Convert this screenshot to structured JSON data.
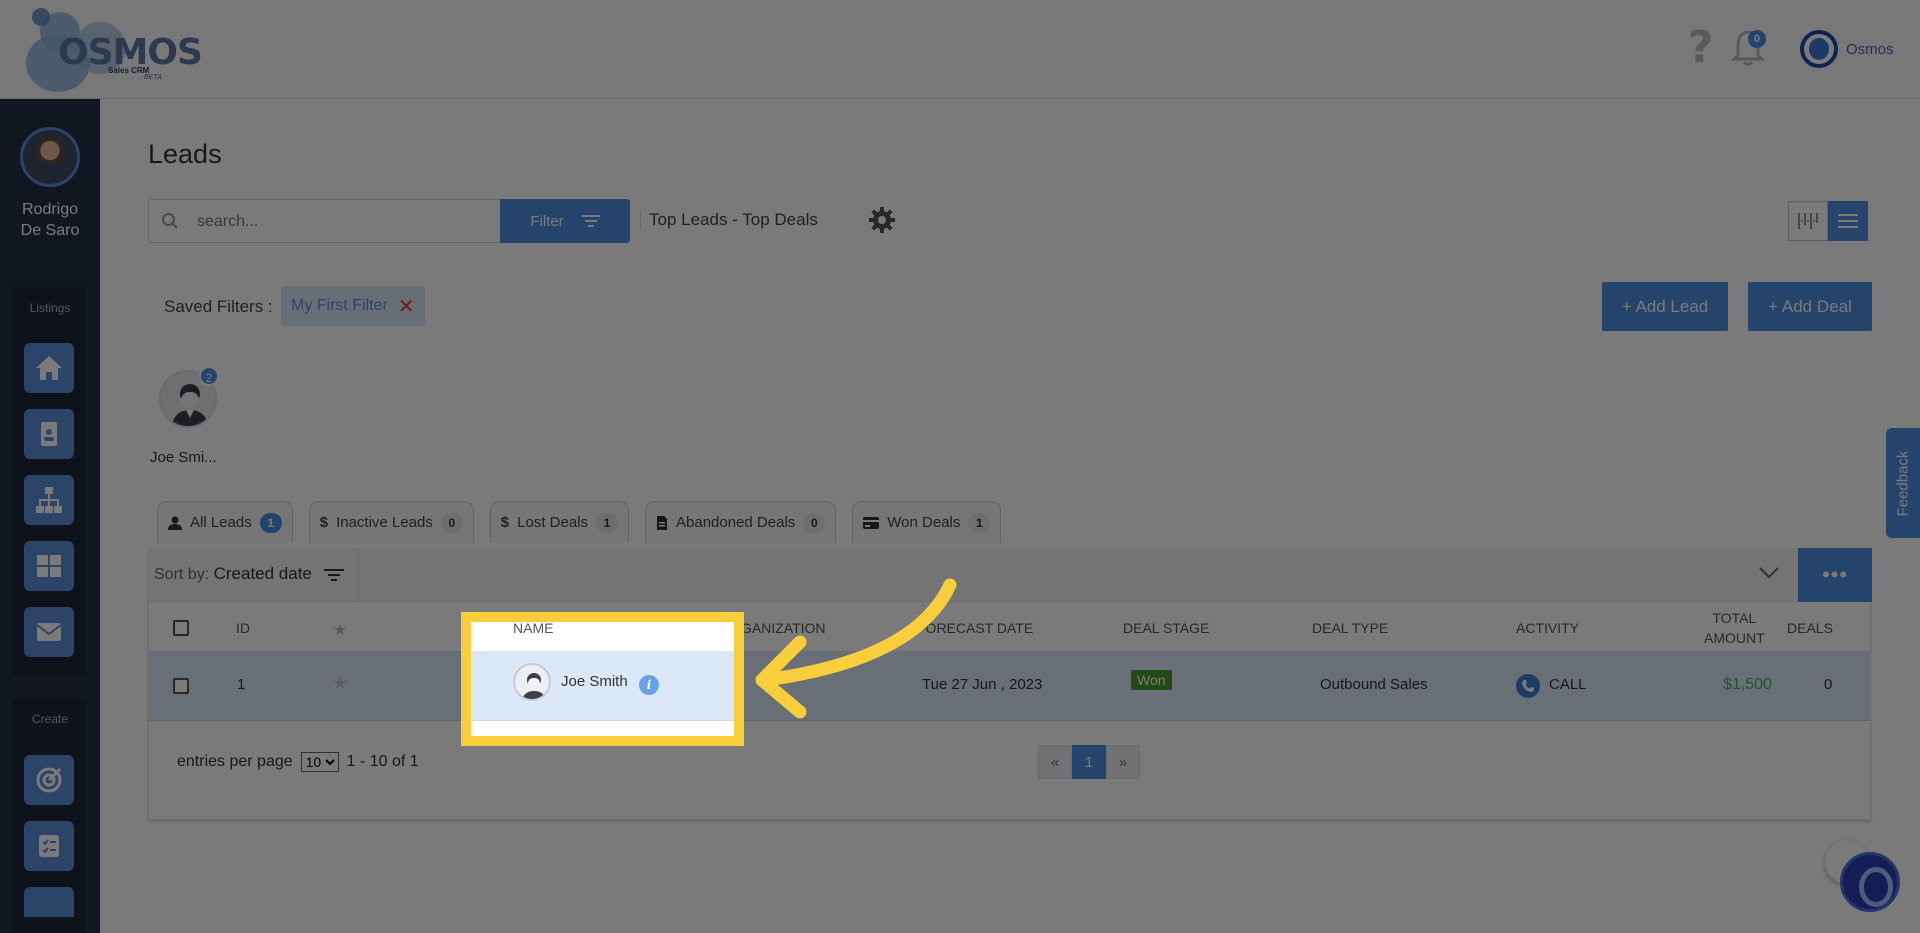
{
  "app": {
    "logo_word": "OSMOS",
    "logo_sub": "Sales CRM",
    "logo_beta": "BETA",
    "notifications_count": "0",
    "top_user": "Osmos"
  },
  "sidebar": {
    "user_first": "Rodrigo",
    "user_last": "De Saro",
    "listings_label": "Listings",
    "create_label": "Create",
    "items": [
      {
        "icon": "home-icon"
      },
      {
        "icon": "contact-card-icon"
      },
      {
        "icon": "org-chart-icon"
      },
      {
        "icon": "grid-icon"
      },
      {
        "icon": "envelope-icon"
      },
      {
        "icon": "target-icon"
      },
      {
        "icon": "checklist-icon"
      }
    ]
  },
  "page": {
    "title": "Leads",
    "search_placeholder": "search...",
    "filter_label": "Filter",
    "top_leads": "Top Leads - Top Deals",
    "saved_filters_label": "Saved Filters :",
    "saved_filter_chip": "My First Filter",
    "add_lead": "+ Add Lead",
    "add_deal": "+ Add Deal"
  },
  "lead_card": {
    "name": "Joe Smi...",
    "badge": "2"
  },
  "tabs": [
    {
      "label": "All Leads",
      "count": "1",
      "icon": "person-icon"
    },
    {
      "label": "Inactive Leads",
      "count": "0",
      "icon": "dollar-icon"
    },
    {
      "label": "Lost Deals",
      "count": "1",
      "icon": "dollar-icon"
    },
    {
      "label": "Abandoned Deals",
      "count": "0",
      "icon": "document-icon"
    },
    {
      "label": "Won Deals",
      "count": "1",
      "icon": "card-icon"
    }
  ],
  "sort": {
    "prefix": "Sort by:",
    "value": "Created date"
  },
  "table": {
    "headers": {
      "id": "ID",
      "name": "NAME",
      "organization": "ORGANIZATION",
      "forecast": "FORECAST DATE",
      "deal_stage": "DEAL STAGE",
      "deal_type": "DEAL TYPE",
      "activity": "ACTIVITY",
      "total_amount_1": "TOTAL",
      "total_amount_2": "AMOUNT",
      "deals": "DEALS"
    },
    "row": {
      "id": "1",
      "name": "Joe Smith",
      "forecast": "Tue 27 Jun , 2023",
      "deal_stage": "Won",
      "deal_type": "Outbound Sales",
      "activity": "CALL",
      "total_amount": "$1,500",
      "deals": "0"
    }
  },
  "footer": {
    "entries_label": "entries per page",
    "per_page": "10",
    "range": "1 - 10 of 1",
    "prev": "«",
    "page": "1",
    "next": "»"
  },
  "feedback_label": "Feedback",
  "colors": {
    "primary": "#4d8ee0",
    "sidebar": "#253046",
    "highlight": "#f9ce3d",
    "won": "#4a9a2a",
    "amount": "#4caf50"
  }
}
